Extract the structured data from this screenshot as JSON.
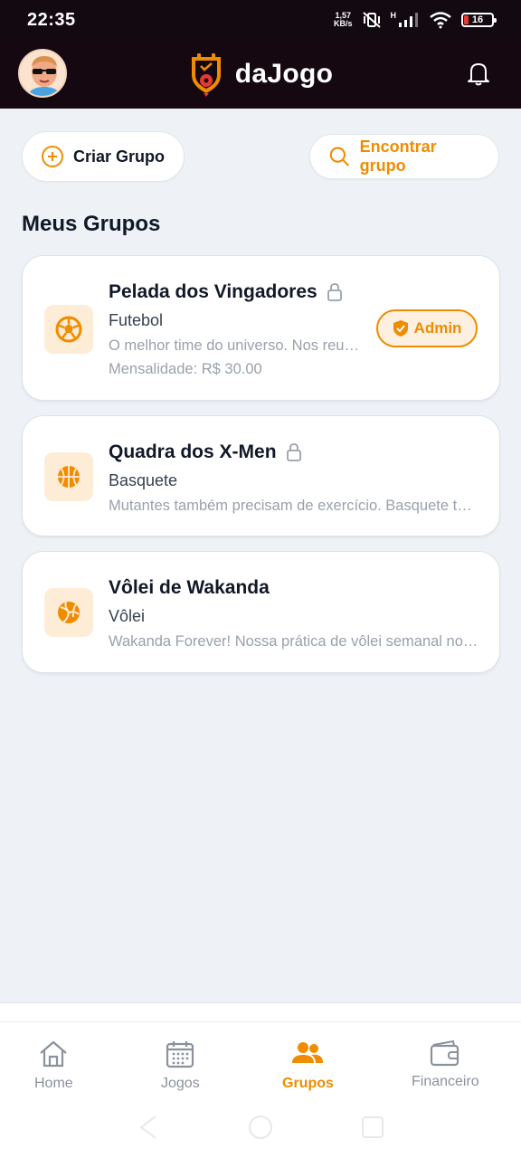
{
  "status_bar": {
    "time": "22:35",
    "net_speed_value": "1,57",
    "net_speed_unit": "KB/s",
    "signal_label": "H",
    "battery": "16",
    "battery_color": "#e53935"
  },
  "header": {
    "app_name": "daJogo",
    "avatar_icon": "user-avatar",
    "logo_icon": "shield-ball-logo",
    "notification_icon": "bell-icon"
  },
  "actions": {
    "create_label": "Criar Grupo",
    "find_label": "Encontrar grupo"
  },
  "section_title": "Meus Grupos",
  "groups": [
    {
      "name": "Pelada dos Vingadores",
      "sport": "Futebol",
      "description": "O melhor time do universo. Nos reunimos toda semana",
      "fee": "Mensalidade: R$ 30.00",
      "badge": "Admin",
      "icon": "soccer-ball-icon",
      "locked": true
    },
    {
      "name": "Quadra dos X-Men",
      "sport": "Basquete",
      "description": "Mutantes também precisam de exercício. Basquete toda semana",
      "icon": "basketball-icon",
      "locked": true
    },
    {
      "name": "Vôlei de Wakanda",
      "sport": "Vôlei",
      "description": "Wakanda Forever! Nossa prática de vôlei semanal no parque",
      "icon": "volleyball-icon",
      "locked": false
    }
  ],
  "nav": [
    {
      "label": "Home",
      "icon": "home-icon",
      "active": false
    },
    {
      "label": "Jogos",
      "icon": "calendar-icon",
      "active": false
    },
    {
      "label": "Grupos",
      "icon": "users-icon",
      "active": true
    },
    {
      "label": "Financeiro",
      "icon": "wallet-icon",
      "active": false
    }
  ],
  "colors": {
    "accent": "#f08c00",
    "header_bg": "#150810",
    "page_bg": "#eef2f7",
    "icon_bg": "#fdecd6"
  }
}
